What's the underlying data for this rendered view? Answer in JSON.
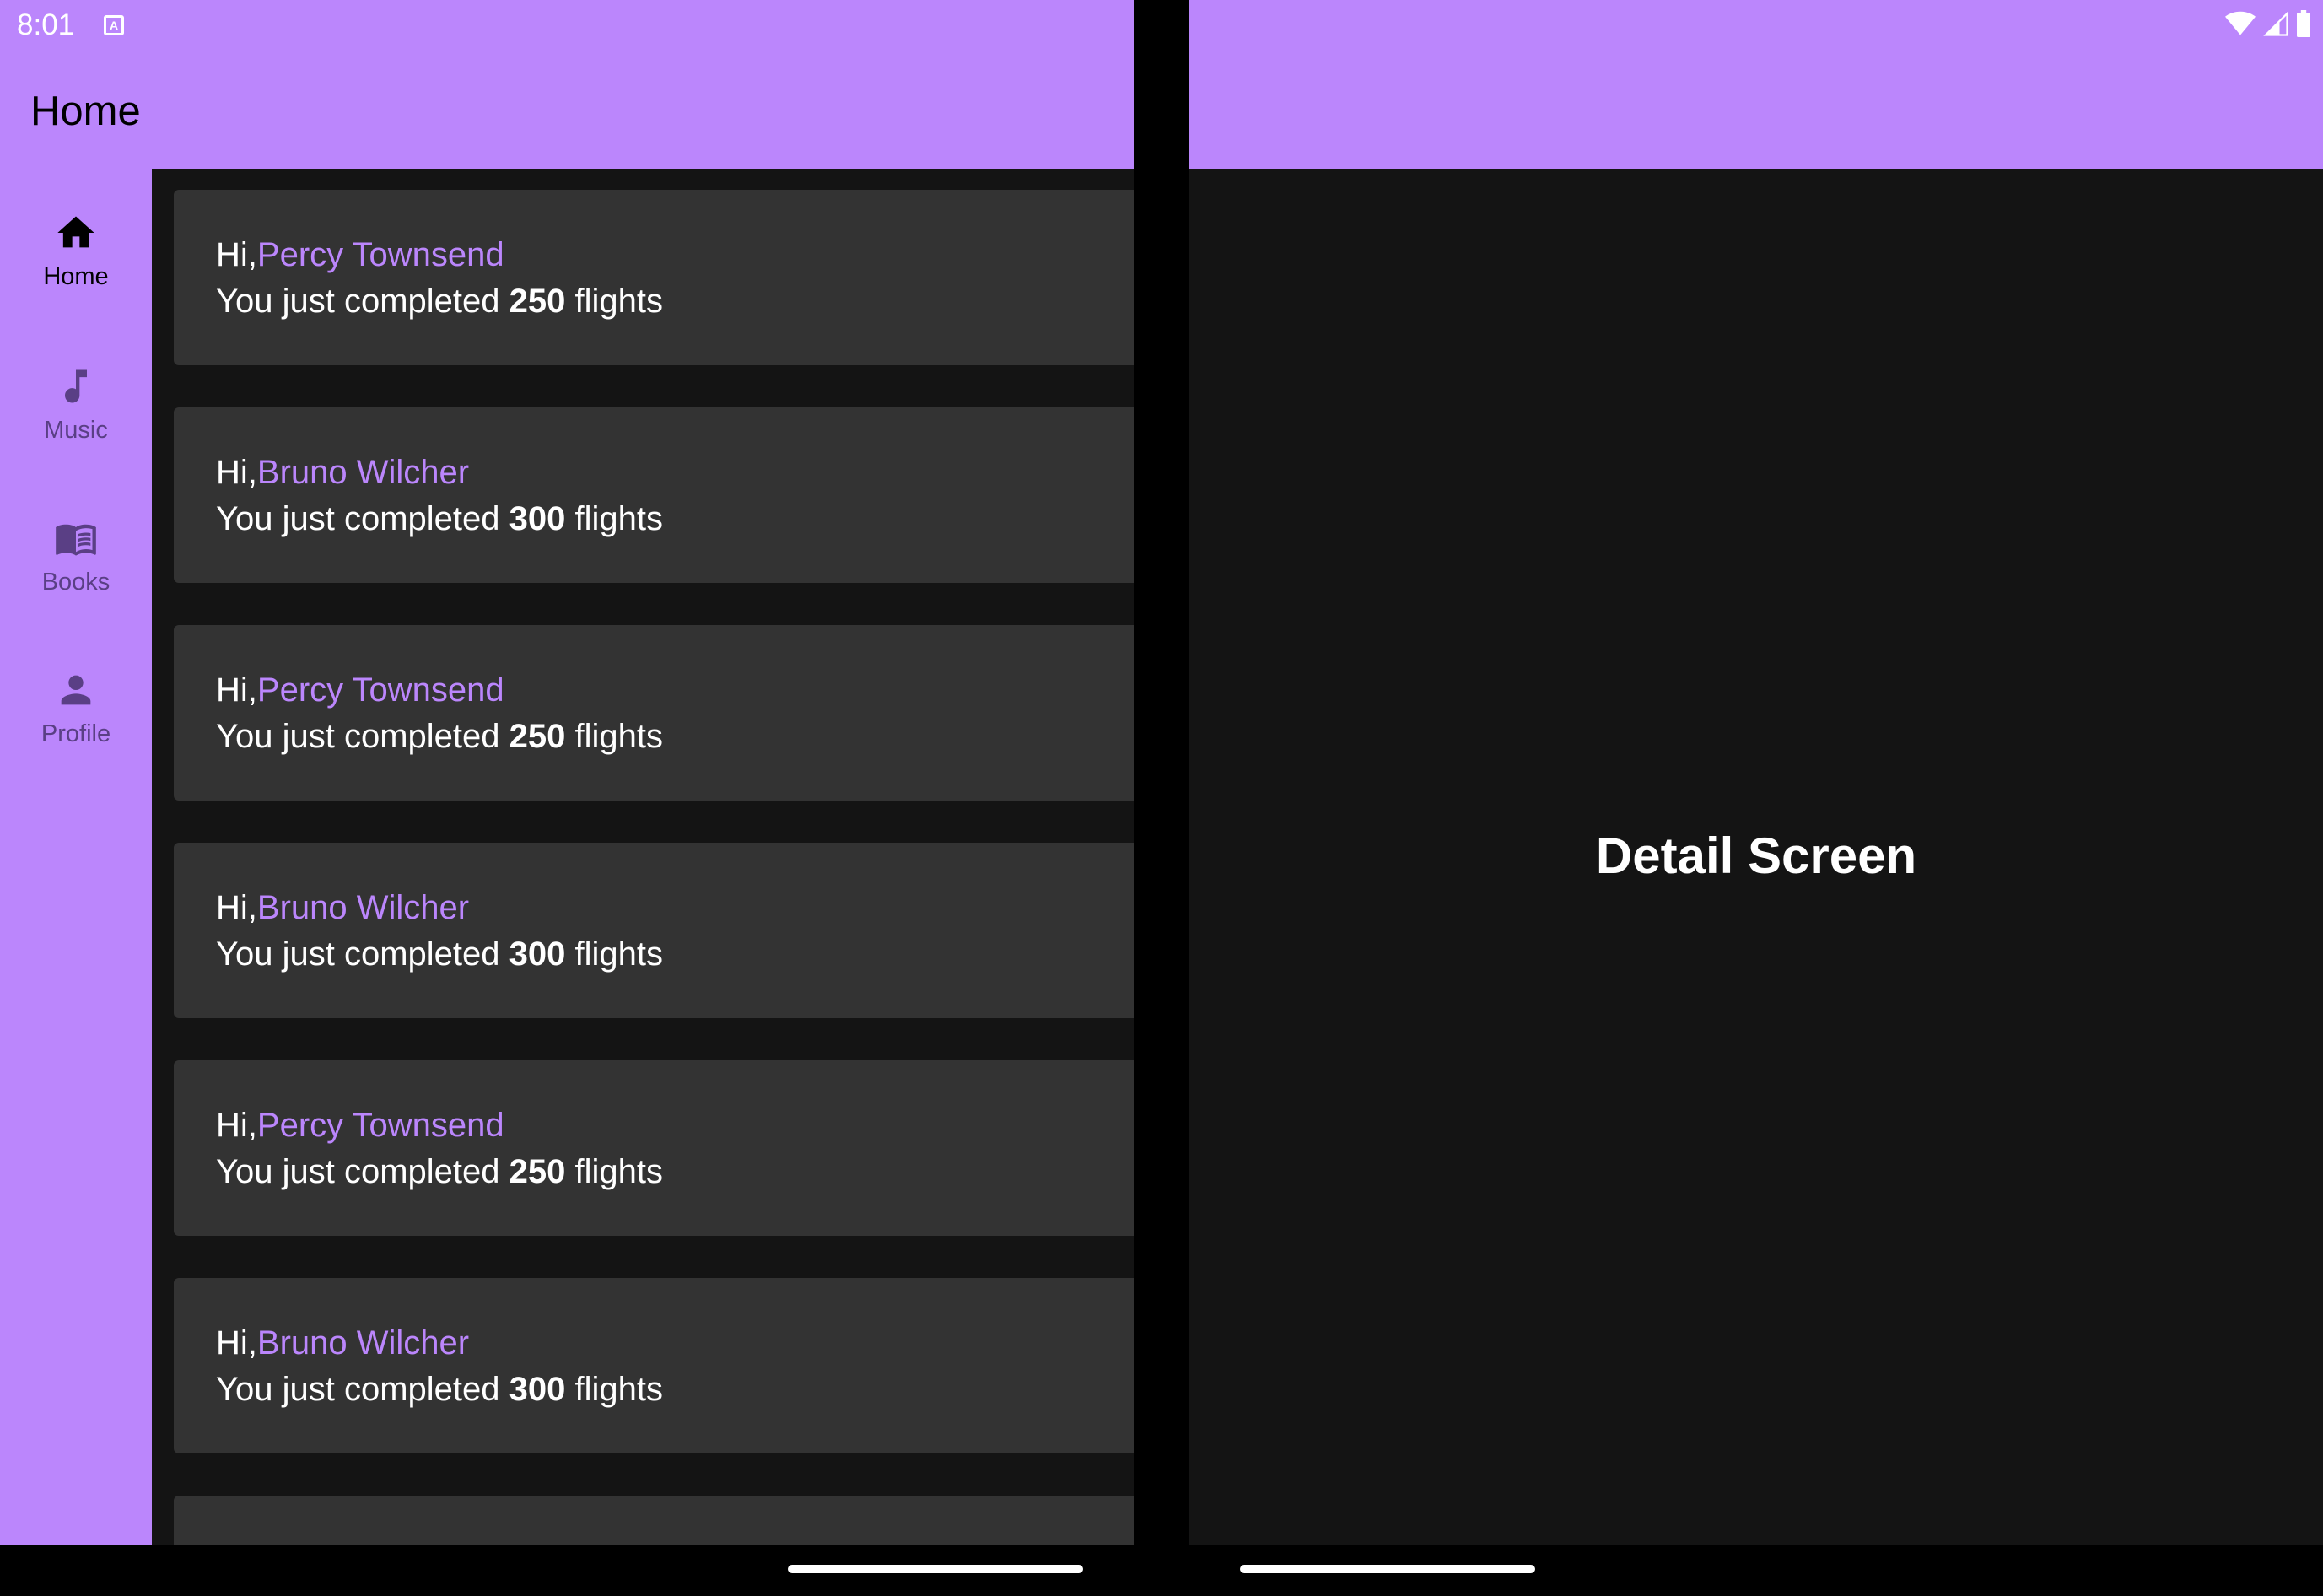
{
  "status_bar": {
    "time": "8:01",
    "notification_icon": "A",
    "icons": [
      "wifi-icon",
      "signal-icon",
      "battery-icon"
    ]
  },
  "app_bar": {
    "title": "Home"
  },
  "nav_rail": {
    "items": [
      {
        "label": "Home",
        "icon": "home-icon",
        "active": true
      },
      {
        "label": "Music",
        "icon": "music-note-icon",
        "active": false
      },
      {
        "label": "Books",
        "icon": "book-icon",
        "active": false
      },
      {
        "label": "Profile",
        "icon": "person-icon",
        "active": false
      }
    ]
  },
  "cards": [
    {
      "greeting": "Hi,",
      "name": "Percy Townsend",
      "prefix": "You just completed ",
      "count": "250",
      "suffix": " flights"
    },
    {
      "greeting": "Hi,",
      "name": "Bruno Wilcher",
      "prefix": "You just completed ",
      "count": "300",
      "suffix": " flights"
    },
    {
      "greeting": "Hi,",
      "name": "Percy Townsend",
      "prefix": "You just completed ",
      "count": "250",
      "suffix": " flights"
    },
    {
      "greeting": "Hi,",
      "name": "Bruno Wilcher",
      "prefix": "You just completed ",
      "count": "300",
      "suffix": " flights"
    },
    {
      "greeting": "Hi,",
      "name": "Percy Townsend",
      "prefix": "You just completed ",
      "count": "250",
      "suffix": " flights"
    },
    {
      "greeting": "Hi,",
      "name": "Bruno Wilcher",
      "prefix": "You just completed ",
      "count": "300",
      "suffix": " flights"
    },
    {
      "greeting": "",
      "name": "",
      "prefix": "",
      "count": "",
      "suffix": ""
    }
  ],
  "detail": {
    "text": "Detail Screen"
  },
  "colors": {
    "accent": "#bb86fc",
    "surface": "#333333",
    "background": "#141414"
  }
}
